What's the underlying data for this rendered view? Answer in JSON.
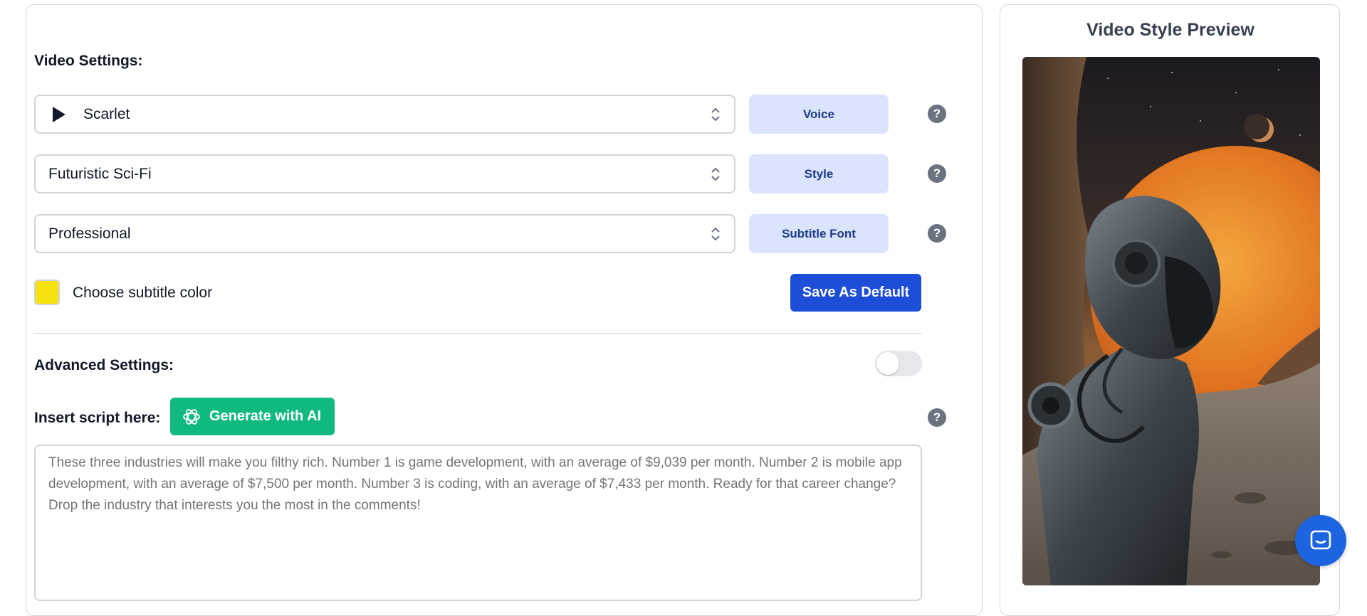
{
  "video_settings": {
    "title": "Video Settings:",
    "voice_select": {
      "value": "Scarlet",
      "button_label": "Voice"
    },
    "style_select": {
      "value": "Futuristic Sci-Fi",
      "button_label": "Style"
    },
    "font_select": {
      "value": "Professional",
      "button_label": "Subtitle Font"
    },
    "help_glyph": "?",
    "subtitle_color": {
      "label": "Choose subtitle color",
      "color": "#f6e20e"
    },
    "save_default_label": "Save As Default"
  },
  "advanced": {
    "title": "Advanced Settings:",
    "toggle_on": false
  },
  "script": {
    "label": "Insert script here:",
    "generate_label": "Generate with AI",
    "placeholder": "These three industries will make you filthy rich. Number 1 is game development, with an average of $9,039 per month. Number 2 is mobile app development, with an average of $7,500 per month. Number 3 is coding, with an average of $7,433 per month. Ready for that career change? Drop the industry that interests you the most in the comments!"
  },
  "preview": {
    "title": "Video Style Preview"
  },
  "colors": {
    "primary": "#1d4ed8",
    "ai_green": "#10b981",
    "tag_bg": "#dbe4fd",
    "chat": "#1d64e0"
  },
  "icons": {
    "play": "play-icon",
    "chevron": "updown-chevron-icon",
    "help": "help-circle-icon",
    "openai": "openai-icon",
    "chat": "chat-icon"
  }
}
